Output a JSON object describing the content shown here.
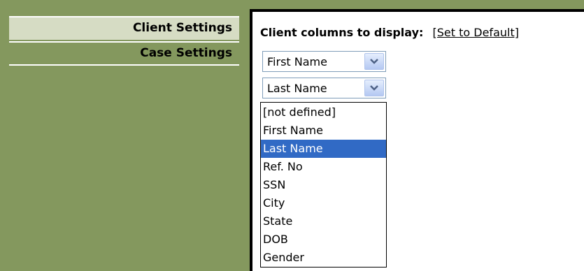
{
  "sidebar": {
    "items": [
      {
        "label": "Client Settings"
      },
      {
        "label": "Case Settings"
      }
    ]
  },
  "main": {
    "heading": "Client columns to display:",
    "default_link": "[Set to Default]",
    "selects": [
      {
        "value": "First Name"
      },
      {
        "value": "Last Name"
      }
    ],
    "dropdown": {
      "options": [
        "[not defined]",
        "First Name",
        "Last Name",
        "Ref. No",
        "SSN",
        "City",
        "State",
        "DOB",
        "Gender"
      ],
      "highlighted": "Last Name"
    }
  },
  "colors": {
    "background": "#84985e",
    "tab_active": "#d6dcc4",
    "highlight": "#316ac5"
  },
  "icons": {
    "select_arrow": "chevron-down-icon"
  }
}
